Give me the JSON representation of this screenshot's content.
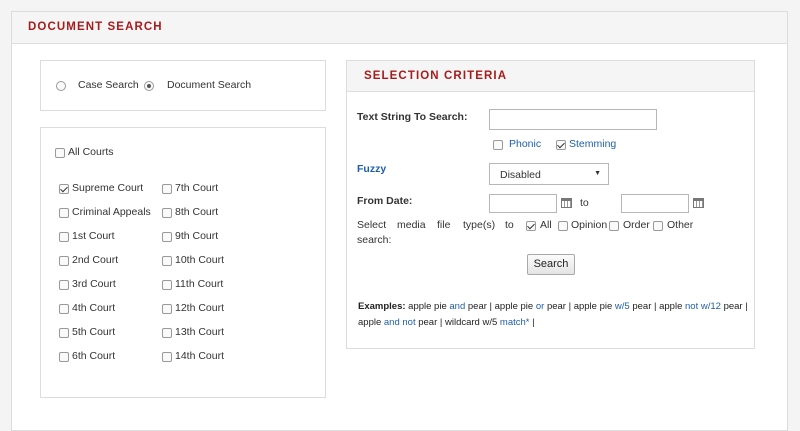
{
  "page": {
    "title": "DOCUMENT SEARCH"
  },
  "search_type": {
    "options": [
      {
        "label": "Case Search",
        "selected": false
      },
      {
        "label": "Document Search",
        "selected": true
      }
    ]
  },
  "courts": {
    "all_label": "All Courts",
    "all_checked": false,
    "left": [
      {
        "label": "Supreme Court",
        "checked": true
      },
      {
        "label": "Criminal Appeals",
        "checked": false
      },
      {
        "label": "1st Court",
        "checked": false
      },
      {
        "label": "2nd Court",
        "checked": false
      },
      {
        "label": "3rd Court",
        "checked": false
      },
      {
        "label": "4th Court",
        "checked": false
      },
      {
        "label": "5th Court",
        "checked": false
      },
      {
        "label": "6th Court",
        "checked": false
      }
    ],
    "right": [
      {
        "label": "7th Court",
        "checked": false
      },
      {
        "label": "8th Court",
        "checked": false
      },
      {
        "label": "9th Court",
        "checked": false
      },
      {
        "label": "10th Court",
        "checked": false
      },
      {
        "label": "11th Court",
        "checked": false
      },
      {
        "label": "12th Court",
        "checked": false
      },
      {
        "label": "13th Court",
        "checked": false
      },
      {
        "label": "14th Court",
        "checked": false
      }
    ]
  },
  "criteria": {
    "title": "SELECTION CRITERIA",
    "text_string_label": "Text String To Search:",
    "text_value": "",
    "phonic_label": "Phonic",
    "phonic_checked": false,
    "stemming_label": "Stemming",
    "stemming_checked": true,
    "fuzzy_label": "Fuzzy",
    "fuzzy_value": "Disabled",
    "from_date_label": "From Date:",
    "from_value": "",
    "to_label": "to",
    "to_value": "",
    "media_words": [
      "Select",
      "media",
      "file",
      "type(s)",
      "to"
    ],
    "media_line2": "search:",
    "media_types": [
      {
        "label": "All",
        "checked": true
      },
      {
        "label": "Opinion",
        "checked": false
      },
      {
        "label": "Order",
        "checked": false
      },
      {
        "label": "Other",
        "checked": false
      }
    ],
    "search_button": "Search"
  },
  "examples": {
    "label": "Examples:",
    "e1": "apple pie",
    "e1op": "and",
    "e1b": "pear",
    "sep": "|",
    "e2": "apple pie",
    "e2op": "or",
    "e2b": "pear",
    "e3": "apple pie",
    "e3op": "w/5",
    "e3b": "pear",
    "e4": "apple",
    "e4op": "not w/12",
    "e4b": "pear",
    "e5": "apple",
    "e5op": "and not",
    "e5b": "pear",
    "e6": "wildcard w/5",
    "e6op": "match*"
  },
  "colors": {
    "accent": "#a61c1c",
    "link": "#1f5fa8"
  }
}
